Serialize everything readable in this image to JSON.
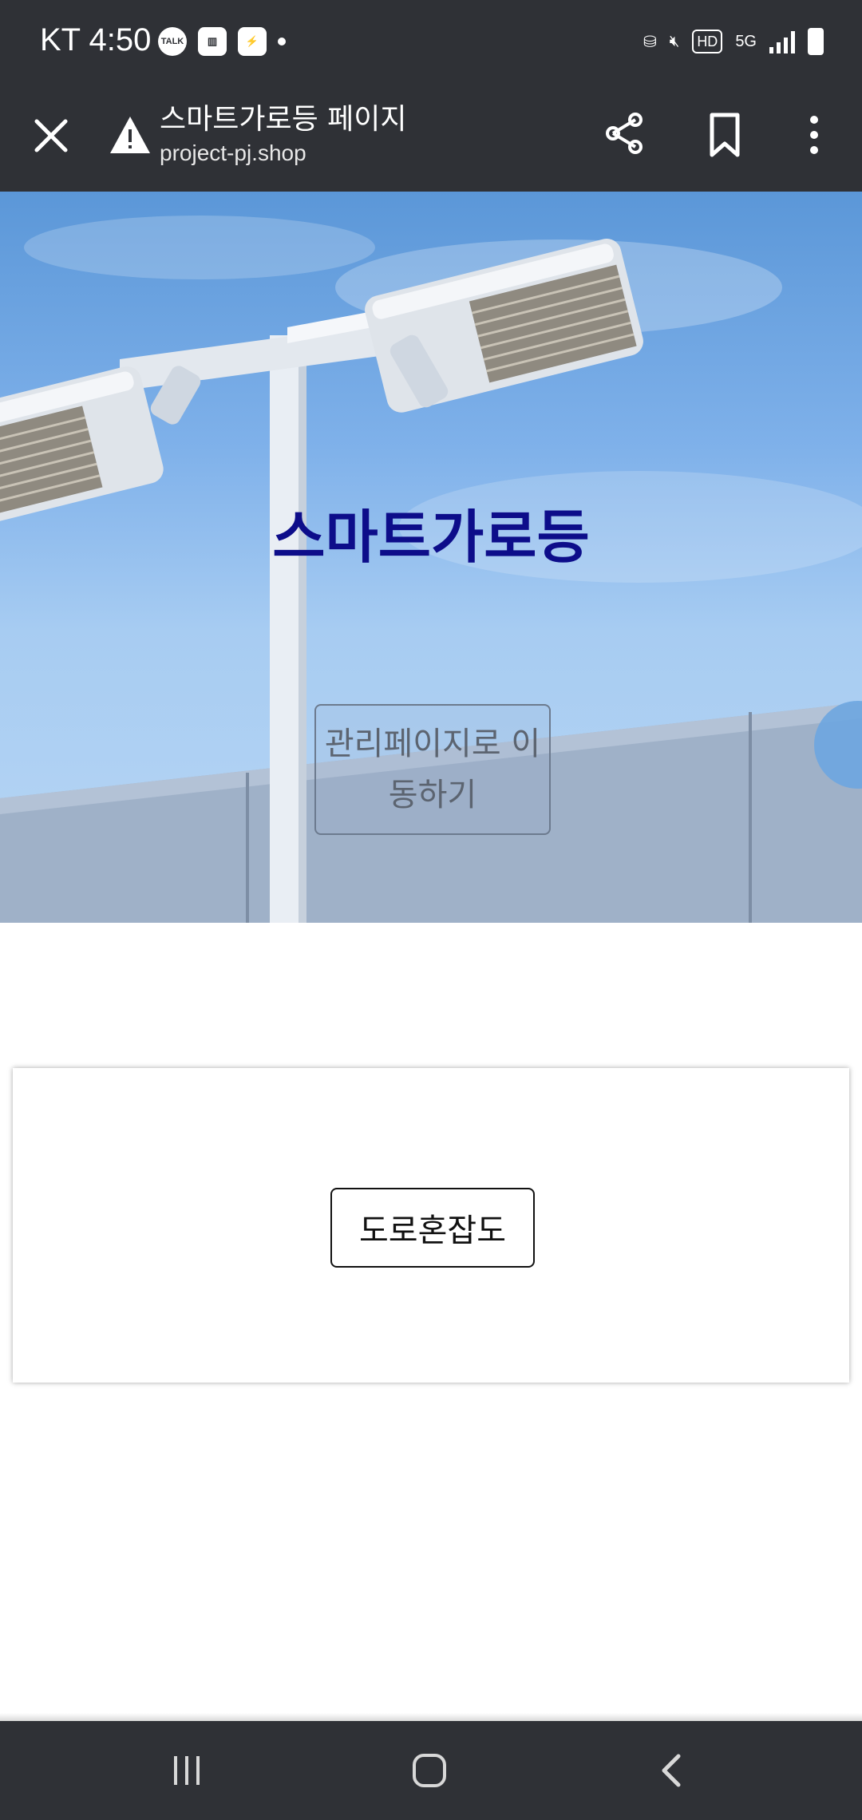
{
  "status_bar": {
    "time": "KT 4:50",
    "notification_talk": "TALK",
    "hd_label": "HD",
    "network_label": "5G"
  },
  "browser": {
    "page_title": "스마트가로등 페이지",
    "url": "project-pj.shop"
  },
  "hero": {
    "title": "스마트가로등",
    "button_label": "관리페이지로 이동하기"
  },
  "card": {
    "button_label": "도로혼잡도"
  },
  "colors": {
    "chrome_bg": "#2f3136",
    "hero_title": "#0d0d8a",
    "sky": "#7fb1ea"
  }
}
